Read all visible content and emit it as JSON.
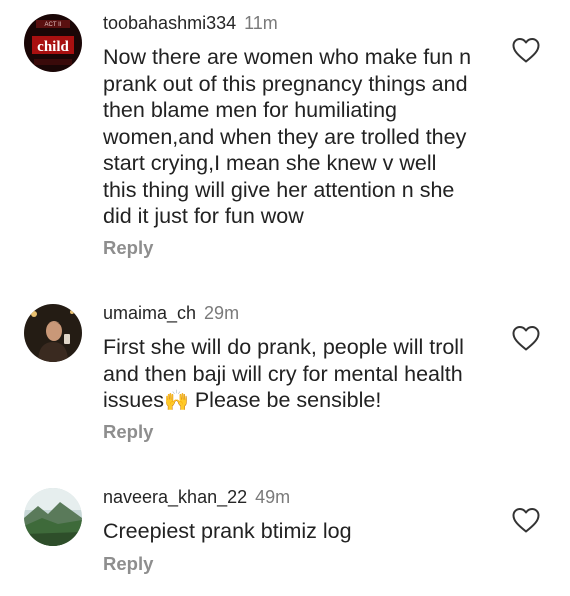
{
  "comments": [
    {
      "username": "toobahashmi334",
      "time": "11m",
      "text": "Now there are women who make fun n\nprank out of this pregnancy things and\nthen blame men for humiliating\nwomen,and when they are trolled they\nstart crying,I mean she knew v well\nthis thing will give her attention n she\ndid it just for fun wow",
      "reply": "Reply",
      "avatar_icon": "child-poster-avatar",
      "like_icon": "heart-outline-icon"
    },
    {
      "username": "umaima_ch",
      "time": "29m",
      "text_before_emoji": "First she will do prank, people will troll\nand then baji will cry for mental health\nissues",
      "emoji": "🙌",
      "text_after_emoji": " Please be sensible!",
      "reply": "Reply",
      "avatar_icon": "woman-photo-avatar",
      "like_icon": "heart-outline-icon"
    },
    {
      "username": "naveera_khan_22",
      "time": "49m",
      "text": "Creepiest prank btimiz log",
      "reply": "Reply",
      "avatar_icon": "landscape-photo-avatar",
      "like_icon": "heart-outline-icon"
    }
  ]
}
